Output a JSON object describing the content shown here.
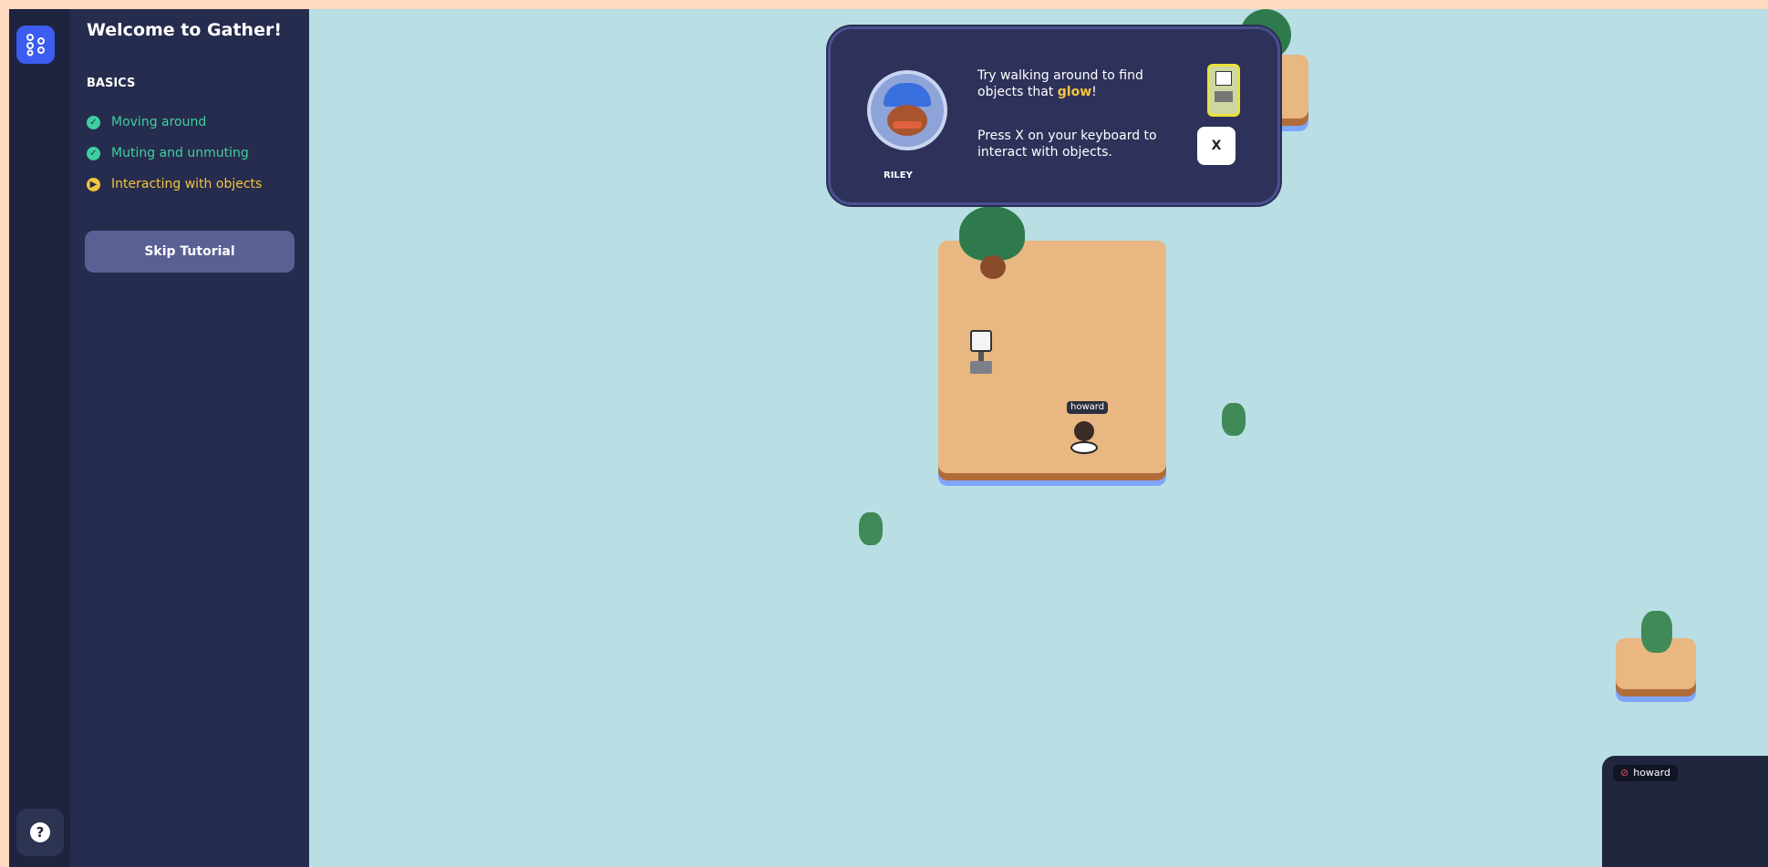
{
  "sidebar": {
    "help_icon": "question-mark-icon",
    "logo_icon": "gather-logo-icon"
  },
  "tutorial": {
    "title": "Welcome to Gather!",
    "section": "BASICS",
    "steps": [
      {
        "label": "Moving around",
        "status": "done"
      },
      {
        "label": "Muting and unmuting",
        "status": "done"
      },
      {
        "label": "Interacting with objects",
        "status": "current"
      }
    ],
    "skip_label": "Skip Tutorial",
    "colors": {
      "done": "#3ecfa0",
      "current": "#f5c43d"
    }
  },
  "tip": {
    "speaker": "RILEY",
    "line1_a": "Try walking around to find objects that ",
    "line1_glow": "glow",
    "line1_b": "!",
    "line2": "Press X on your keyboard to interact with objects.",
    "key_label": "X"
  },
  "player": {
    "name": "howard"
  },
  "video_tile": {
    "name": "howard",
    "muted": true
  }
}
